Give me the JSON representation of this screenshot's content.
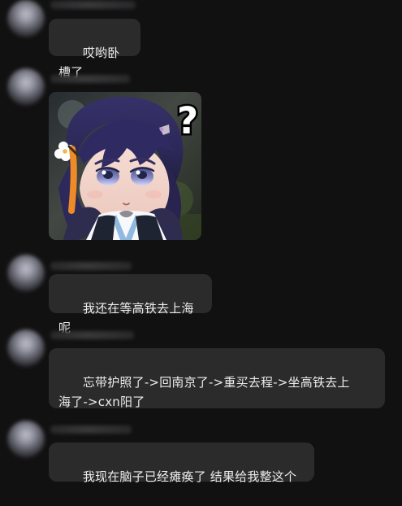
{
  "messages": [
    {
      "sender": "",
      "text": "哎哟卧槽了"
    },
    {
      "sender": "",
      "image": {
        "icon": "question-mark-icon",
        "symbol": "?"
      }
    },
    {
      "sender": "",
      "text": "我还在等高铁去上海呢"
    },
    {
      "sender": "",
      "text": "忘带护照了->回南京了->重买去程->坐高铁去上\n海了->cxn阳了"
    },
    {
      "sender": "",
      "text": "我现在脑子已经瘫痪了 结果给我整这个"
    }
  ]
}
